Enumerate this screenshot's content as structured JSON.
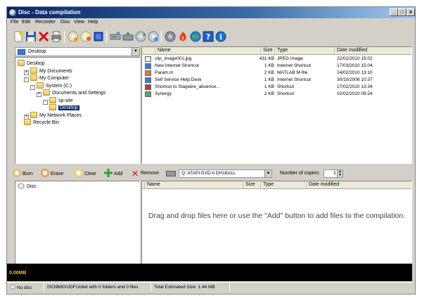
{
  "window": {
    "title": "Disc - Data compilation"
  },
  "window_controls": {
    "minimize": "_",
    "restore": "□",
    "close": "x"
  },
  "menu": [
    "File",
    "Edit",
    "Recorder",
    "Disc",
    "View",
    "Help"
  ],
  "toolbar_icons": [
    "new-icon",
    "save-icon",
    "delete-icon",
    "print-icon",
    "copy-disc-icon",
    "blank-disc-icon",
    "disc-info-icon",
    "drive-icon",
    "eject-icon",
    "cd-rip-icon",
    "cd-player-icon",
    "burn-settings-icon",
    "fire-icon",
    "globe-icon",
    "help-icon",
    "info-icon"
  ],
  "location_combo": {
    "value": "Desktop"
  },
  "tree": [
    {
      "label": "Desktop",
      "indent": 0,
      "toggle": ""
    },
    {
      "label": "My Documents",
      "indent": 1,
      "toggle": "+"
    },
    {
      "label": "My Computer",
      "indent": 1,
      "toggle": "-"
    },
    {
      "label": "System (C:)",
      "indent": 2,
      "toggle": "-"
    },
    {
      "label": "Documents and Settings",
      "indent": 3,
      "toggle": "+"
    },
    {
      "label": "sp-site",
      "indent": 4,
      "toggle": "-"
    },
    {
      "label": "Desktop",
      "indent": 5,
      "toggle": "",
      "selected": true
    },
    {
      "label": "My Network Places",
      "indent": 1,
      "toggle": "+"
    },
    {
      "label": "Recycle Bin",
      "indent": 1,
      "toggle": ""
    }
  ],
  "file_list": {
    "columns": [
      "Name",
      "Size",
      "Type",
      "Date modified"
    ],
    "rows": [
      {
        "name": "clip_image001.jpg",
        "size": "431 KB",
        "type": "JPEG Image",
        "date": "22/02/2010 15:02",
        "color": "#f2f2f2"
      },
      {
        "name": "New Internet Shortcut",
        "size": "1 KB",
        "type": "Internet Shortcut",
        "date": "17/03/2010 15:04",
        "color": "#3a7bd5"
      },
      {
        "name": "Param.m",
        "size": "2 KB",
        "type": "MATLAB M-file",
        "date": "24/02/2010 13:10",
        "color": "#e07a2a"
      },
      {
        "name": "Self Service Help Desk",
        "size": "1 KB",
        "type": "Internet Shortcut",
        "date": "30/10/2008 10:37",
        "color": "#3a7bd5"
      },
      {
        "name": "Shortcut to Stagiaire_absence...",
        "size": "1 KB",
        "type": "Shortcut",
        "date": "17/02/2010 13:34",
        "color": "#cc3333"
      },
      {
        "name": "Synergy",
        "size": "2 KB",
        "type": "Shortcut",
        "date": "02/02/2010 09:24",
        "color": "#4caf50"
      }
    ]
  },
  "action_toolbar": {
    "burn": "Burn",
    "erase": "Erase",
    "clear": "Clear",
    "add": "Add",
    "remove": "Remove",
    "drive": "Q: ATAPI DVD A  DH16A1L",
    "copies_label": "Number of copies:",
    "copies_value": "1"
  },
  "compilation_tree": {
    "root": "Disc"
  },
  "compilation_list": {
    "columns": [
      "Name",
      "Size",
      "Type",
      "Date modified"
    ],
    "drop_message": "Drag and drop files here or use the \"Add\" button to add files to the compilation."
  },
  "size_bar": {
    "value": "0.00MB"
  },
  "status": {
    "disc": "No disc",
    "format": "ISO9660/UDF/Joliet with 0 folders and 0 files",
    "total": "Total Estimated Size: 1.44 MB"
  },
  "colors": {
    "titlebar": "#0a246a",
    "selection": "#0a246a",
    "sizebar_text": "#f0c020"
  }
}
